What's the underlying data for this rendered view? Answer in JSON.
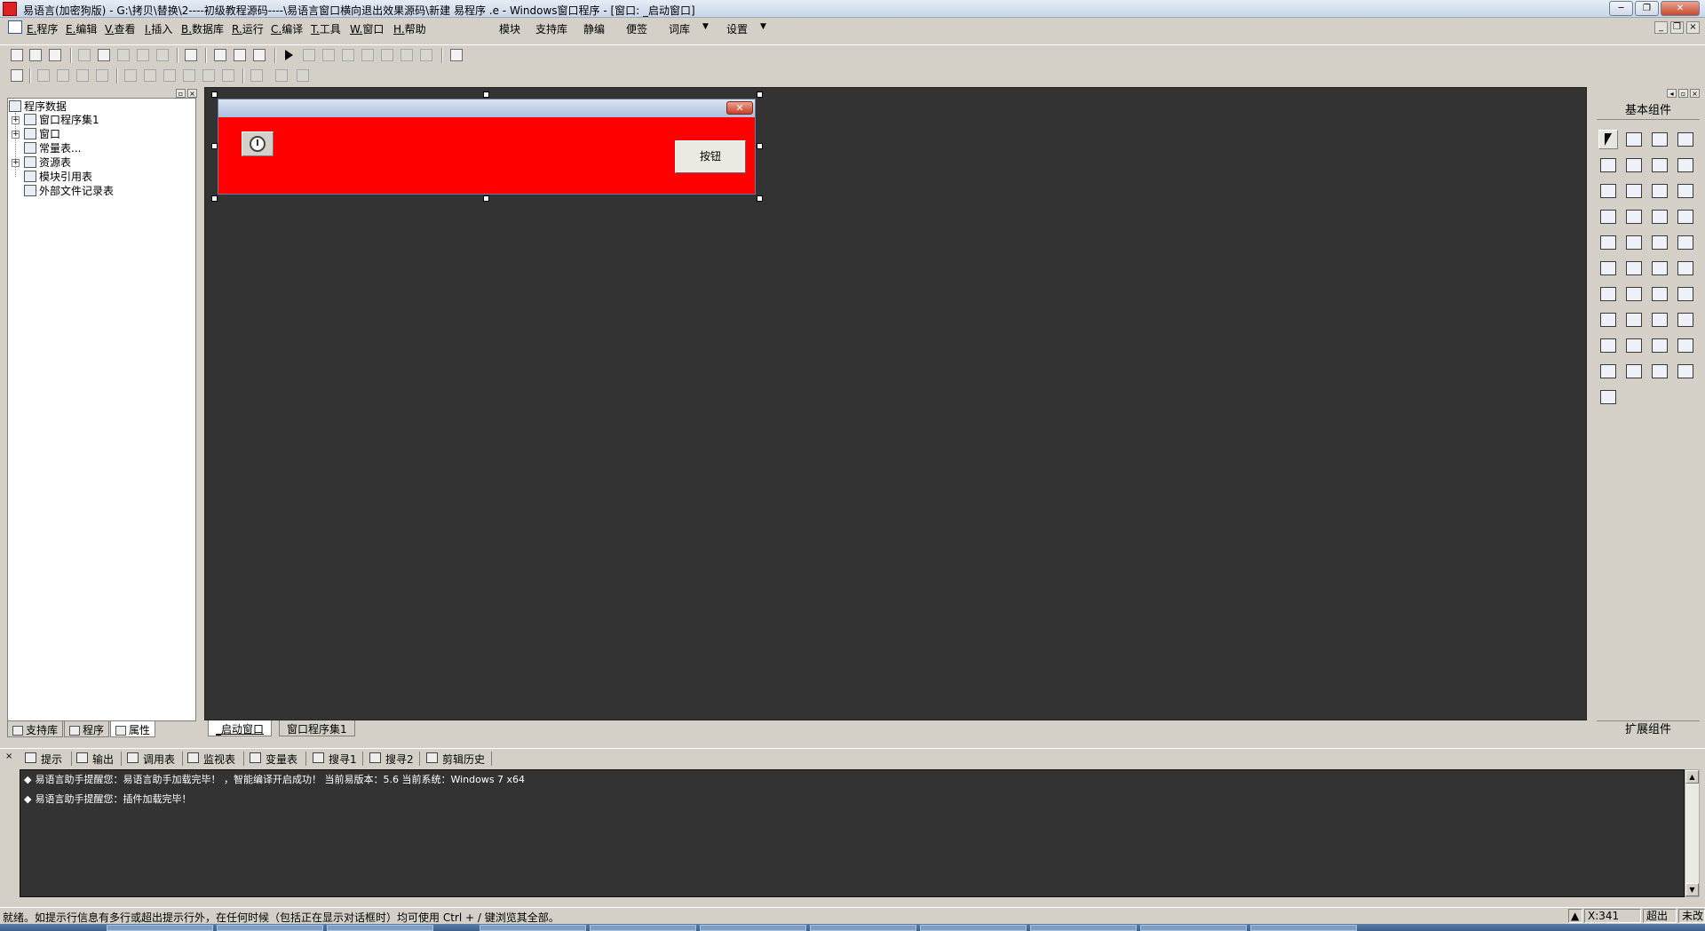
{
  "window": {
    "title": "易语言(加密狗版) - G:\\拷贝\\替换\\2----初级教程源码----\\易语言窗口横向退出效果源码\\新建 易程序 .e - Windows窗口程序 - [窗口: _启动窗口]",
    "controls": [
      "─",
      "❐",
      "✕"
    ]
  },
  "menu": {
    "items": [
      {
        "key": "E.",
        "label": "程序"
      },
      {
        "key": "E.",
        "label": "编辑"
      },
      {
        "key": "V.",
        "label": "查看"
      },
      {
        "key": "I.",
        "label": "插入"
      },
      {
        "key": "B.",
        "label": "数据库"
      },
      {
        "key": "R.",
        "label": "运行"
      },
      {
        "key": "C.",
        "label": "编译"
      },
      {
        "key": "T.",
        "label": "工具"
      },
      {
        "key": "W.",
        "label": "窗口"
      },
      {
        "key": "H.",
        "label": "帮助"
      }
    ],
    "extra": [
      "模块",
      "支持库",
      "静编",
      "便签",
      "词库",
      "设置"
    ],
    "mdi_controls": [
      "_",
      "❐",
      "×"
    ]
  },
  "left_panel": {
    "tree": {
      "root": "程序数据",
      "children": [
        "窗口程序集1",
        "窗口",
        "常量表...",
        "资源表",
        "模块引用表",
        "外部文件记录表"
      ]
    },
    "tabs": [
      "支持库",
      "程序",
      "属性"
    ],
    "header_buttons": [
      "▫",
      "×"
    ]
  },
  "designer": {
    "form_close": "✕",
    "button_label": "按钮",
    "form_color": "#ff0000",
    "background_color": "#333333"
  },
  "doc_tabs": [
    "_启动窗口",
    "窗口程序集1"
  ],
  "right_panel": {
    "header": "基本组件",
    "footer": "扩展组件",
    "header_buttons": [
      "◂",
      "▫",
      "×"
    ]
  },
  "output": {
    "close": "×",
    "tabs": [
      "提示",
      "输出",
      "调用表",
      "监视表",
      "变量表",
      "搜寻1",
      "搜寻2",
      "剪辑历史"
    ],
    "lines": [
      "易语言助手提醒您：易语言助手加载完毕！ ，智能编译开启成功！ 当前易版本：5.6  当前系统：Windows 7 x64",
      "易语言助手提醒您：插件加载完毕！"
    ],
    "bullet": "◆",
    "scroll_up": "▲",
    "scroll_down": "▼"
  },
  "status": {
    "message": "就绪。如提示行信息有多行或超出提示行外，在任何时候（包括正在显示对话框时）均可使用 Ctrl + / 键浏览其全部。",
    "arrow": "▲",
    "coord": "X:341",
    "mode": "超出",
    "modified": "未改"
  }
}
